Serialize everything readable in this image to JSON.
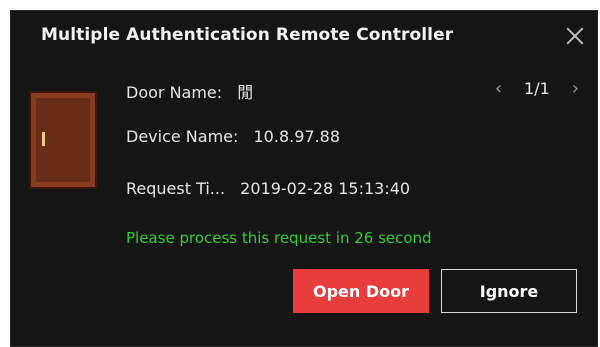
{
  "dialog": {
    "title": "Multiple Authentication Remote Controller",
    "close_icon": "close-icon"
  },
  "door_icon": "door-icon",
  "fields": {
    "door_name_label": "Door Name:",
    "door_name_value": "閒",
    "device_name_label": "Device Name:",
    "device_name_value": "10.8.97.88",
    "request_time_label": "Request Ti...",
    "request_time_value": "2019-02-28 15:13:40"
  },
  "pager": {
    "prev_icon": "chevron-left-icon",
    "text": "1/1",
    "next_icon": "chevron-right-icon"
  },
  "notice": {
    "text": "Please process this request in 26 second",
    "color": "#33cc33"
  },
  "buttons": {
    "open": {
      "label": "Open Door",
      "color": "#e83d3d"
    },
    "ignore": {
      "label": "Ignore"
    }
  }
}
